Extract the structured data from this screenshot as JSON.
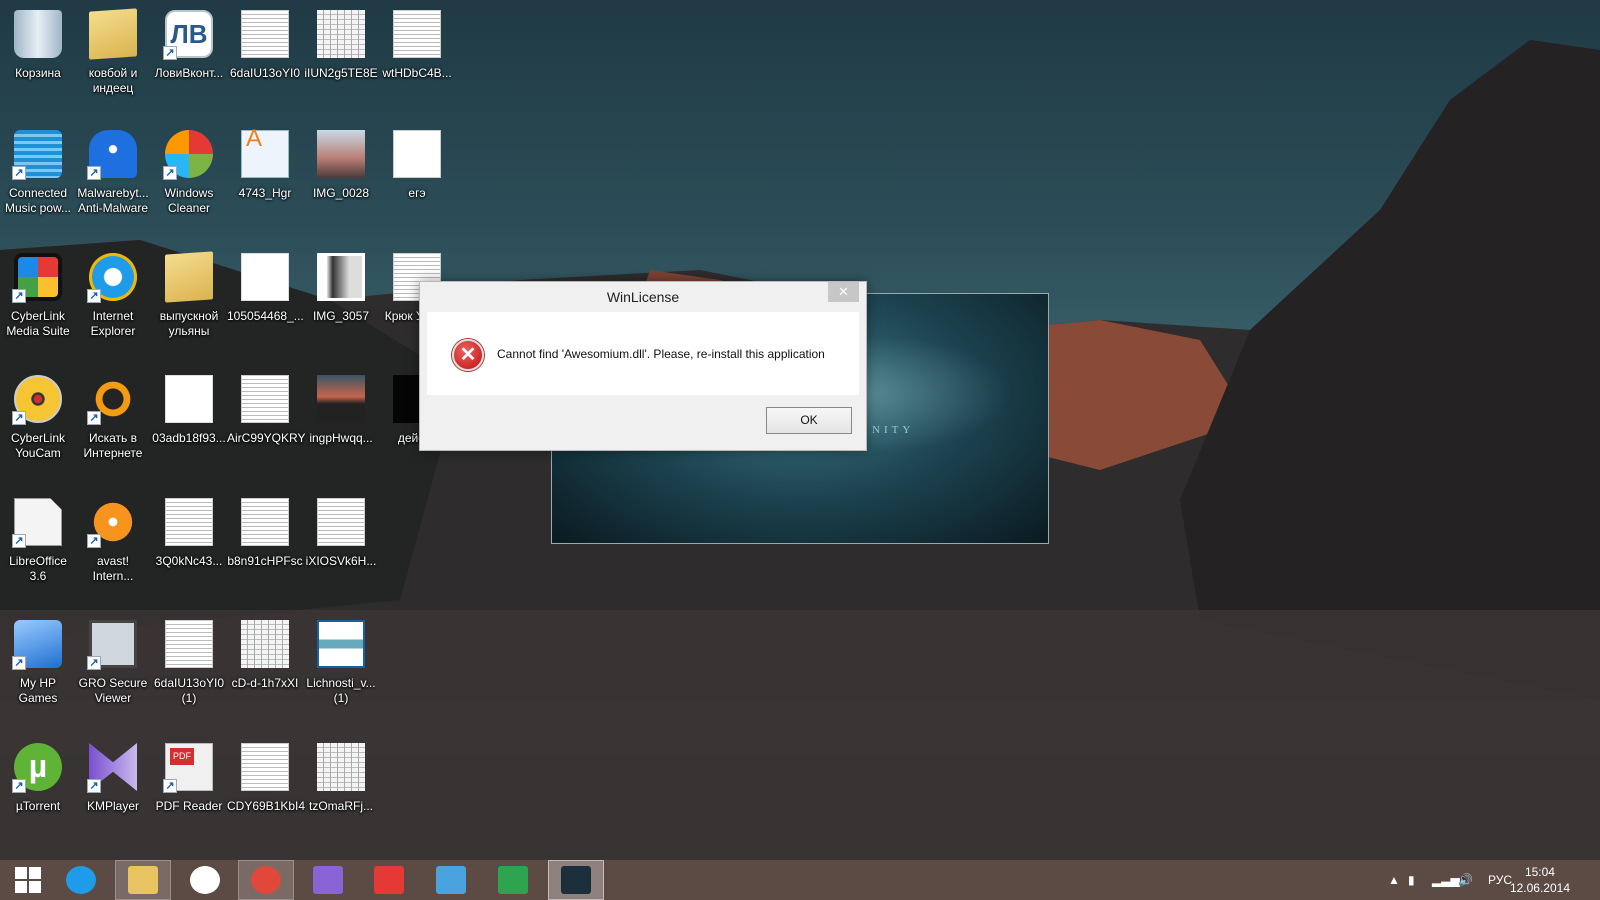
{
  "desktop": {
    "columns": [
      [
        {
          "label": "Корзина",
          "icon": "recycle-bin-icon",
          "kind": "recycle",
          "shortcut": false
        },
        {
          "label": "Connected Music pow...",
          "icon": "connected-music-icon",
          "kind": "music",
          "shortcut": true
        },
        {
          "label": "CyberLink Media Suite",
          "icon": "cyberlink-media-suite-icon",
          "kind": "cyberlink",
          "shortcut": true
        },
        {
          "label": "CyberLink YouCam",
          "icon": "cyberlink-youcam-icon",
          "kind": "youcam",
          "shortcut": true
        },
        {
          "label": "LibreOffice 3.6",
          "icon": "libreoffice-icon",
          "kind": "libre",
          "shortcut": true
        },
        {
          "label": "My HP Games",
          "icon": "hp-games-icon",
          "kind": "hpgames",
          "shortcut": true
        },
        {
          "label": "µTorrent",
          "icon": "utorrent-icon",
          "kind": "utorrent",
          "shortcut": true,
          "glyph": "µ"
        }
      ],
      [
        {
          "label": "ковбой и индеец",
          "icon": "folder-icon",
          "kind": "folder",
          "shortcut": false
        },
        {
          "label": "Malwarebyt... Anti-Malware",
          "icon": "malwarebytes-icon",
          "kind": "malware",
          "shortcut": true
        },
        {
          "label": "Internet Explorer",
          "icon": "internet-explorer-icon",
          "kind": "ie",
          "shortcut": true
        },
        {
          "label": "Искать в Интернете",
          "icon": "search-internet-icon",
          "kind": "search",
          "shortcut": true
        },
        {
          "label": "avast! Intern...",
          "icon": "avast-icon",
          "kind": "avast",
          "shortcut": true
        },
        {
          "label": "GRO Secure Viewer",
          "icon": "gro-secure-viewer-icon",
          "kind": "gro",
          "shortcut": true
        },
        {
          "label": "KMPlayer",
          "icon": "kmplayer-icon",
          "kind": "kmplayer",
          "shortcut": true
        }
      ],
      [
        {
          "label": "ЛовиВконт...",
          "icon": "lovivkontakte-icon",
          "kind": "lv",
          "shortcut": true,
          "glyph": "ЛВ"
        },
        {
          "label": "Windows Cleaner",
          "icon": "windows-cleaner-icon",
          "kind": "clover",
          "shortcut": true
        },
        {
          "label": "выпускной ульяны",
          "icon": "folder-icon",
          "kind": "folder",
          "shortcut": false
        },
        {
          "label": "03adb18f93...",
          "icon": "image-thumbnail-icon",
          "kind": "sketch",
          "shortcut": false
        },
        {
          "label": "3Q0kNc43...",
          "icon": "document-thumbnail-icon",
          "kind": "doc",
          "shortcut": false
        },
        {
          "label": "6daIU13oYI0 (1)",
          "icon": "document-thumbnail-icon",
          "kind": "doc",
          "shortcut": false
        },
        {
          "label": "PDF Reader",
          "icon": "pdf-reader-icon",
          "kind": "pdf",
          "shortcut": true
        }
      ],
      [
        {
          "label": "6daIU13oYI0",
          "icon": "document-thumbnail-icon",
          "kind": "doc",
          "shortcut": false
        },
        {
          "label": "4743_Hgr",
          "icon": "wordpad-document-icon",
          "kind": "wordpad",
          "shortcut": false,
          "glyph": "A"
        },
        {
          "label": "105054468_...",
          "icon": "image-thumbnail-icon",
          "kind": "sketch",
          "shortcut": false
        },
        {
          "label": "AirC99YQKRY",
          "icon": "document-thumbnail-icon",
          "kind": "doc",
          "shortcut": false
        },
        {
          "label": "b8n91cHPFsc",
          "icon": "document-thumbnail-icon",
          "kind": "doc",
          "shortcut": false
        },
        {
          "label": "cD-d-1h7xXI",
          "icon": "document-thumbnail-icon",
          "kind": "sheet",
          "shortcut": false
        },
        {
          "label": "CDY69B1KbI4",
          "icon": "document-thumbnail-icon",
          "kind": "doc",
          "shortcut": false
        }
      ],
      [
        {
          "label": "iIUN2g5TE8E",
          "icon": "spreadsheet-thumbnail-icon",
          "kind": "sheet",
          "shortcut": false
        },
        {
          "label": "IMG_0028",
          "icon": "photo-thumbnail-icon",
          "kind": "photo",
          "shortcut": false
        },
        {
          "label": "IMG_3057",
          "icon": "photo-thumbnail-icon",
          "kind": "portrait",
          "shortcut": false
        },
        {
          "label": "ingpHwqq...",
          "icon": "photo-thumbnail-icon",
          "kind": "sunset",
          "shortcut": false
        },
        {
          "label": "iXIOSVk6H...",
          "icon": "document-thumbnail-icon",
          "kind": "doc",
          "shortcut": false
        },
        {
          "label": "Lichnosti_v... (1)",
          "icon": "writer-document-icon",
          "kind": "lichnosti",
          "shortcut": false
        },
        {
          "label": "tzOmaRFj...",
          "icon": "spreadsheet-thumbnail-icon",
          "kind": "sheet",
          "shortcut": false
        }
      ],
      [
        {
          "label": "wtHDbC4B...",
          "icon": "document-thumbnail-icon",
          "kind": "doc",
          "shortcut": false
        },
        {
          "label": "егэ",
          "icon": "writer-document-icon",
          "kind": "page",
          "shortcut": false
        },
        {
          "label": "Крюк Ульян",
          "icon": "presentation-thumbnail-icon",
          "kind": "doc",
          "shortcut": false
        },
        {
          "label": "действ",
          "icon": "video-thumbnail-icon",
          "kind": "dark",
          "shortcut": false
        }
      ]
    ]
  },
  "launcher": {
    "tagline": "NITY"
  },
  "dialog": {
    "title": "WinLicense",
    "close_glyph": "✕",
    "error_glyph": "✕",
    "message": "Cannot find 'Awesomium.dll'. Please, re-install this application",
    "ok_label": "OK"
  },
  "taskbar": {
    "items": [
      {
        "name": "start-button",
        "color": "#ffffff",
        "state": ""
      },
      {
        "name": "internet-explorer-taskbar",
        "color": "#1e9be9",
        "state": ""
      },
      {
        "name": "file-explorer-taskbar",
        "color": "#e8c460",
        "state": "open"
      },
      {
        "name": "hp-taskbar",
        "color": "#ffffff",
        "state": ""
      },
      {
        "name": "chrome-taskbar",
        "color": "#e0483a",
        "state": "open"
      },
      {
        "name": "kmplayer-taskbar",
        "color": "#8a63d6",
        "state": ""
      },
      {
        "name": "yandex-taskbar",
        "color": "#e53935",
        "state": ""
      },
      {
        "name": "volume-app-taskbar",
        "color": "#4aa3df",
        "state": ""
      },
      {
        "name": "store-taskbar",
        "color": "#2ea44f",
        "state": ""
      },
      {
        "name": "aion-taskbar",
        "color": "#1b2f3a",
        "state": "active"
      }
    ],
    "language": "РУС",
    "time": "15:04",
    "date": "12.06.2014"
  }
}
